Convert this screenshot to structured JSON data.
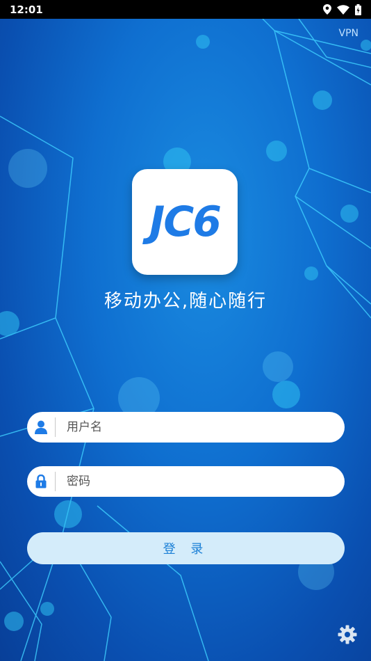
{
  "statusbar": {
    "time": "12:01",
    "icons": [
      "location-icon",
      "wifi-icon",
      "battery-icon"
    ]
  },
  "header": {
    "vpn_label": "VPN"
  },
  "logo": {
    "text": "JC6"
  },
  "slogan": "移动办公,随心随行",
  "form": {
    "username_placeholder": "用户名",
    "password_placeholder": "密码",
    "login_label": "登 录"
  },
  "footer": {
    "settings_icon": "gear-icon"
  },
  "colors": {
    "background": "#0f6fd0",
    "accent": "#1e7be6",
    "button_bg": "#d4ecfa"
  }
}
